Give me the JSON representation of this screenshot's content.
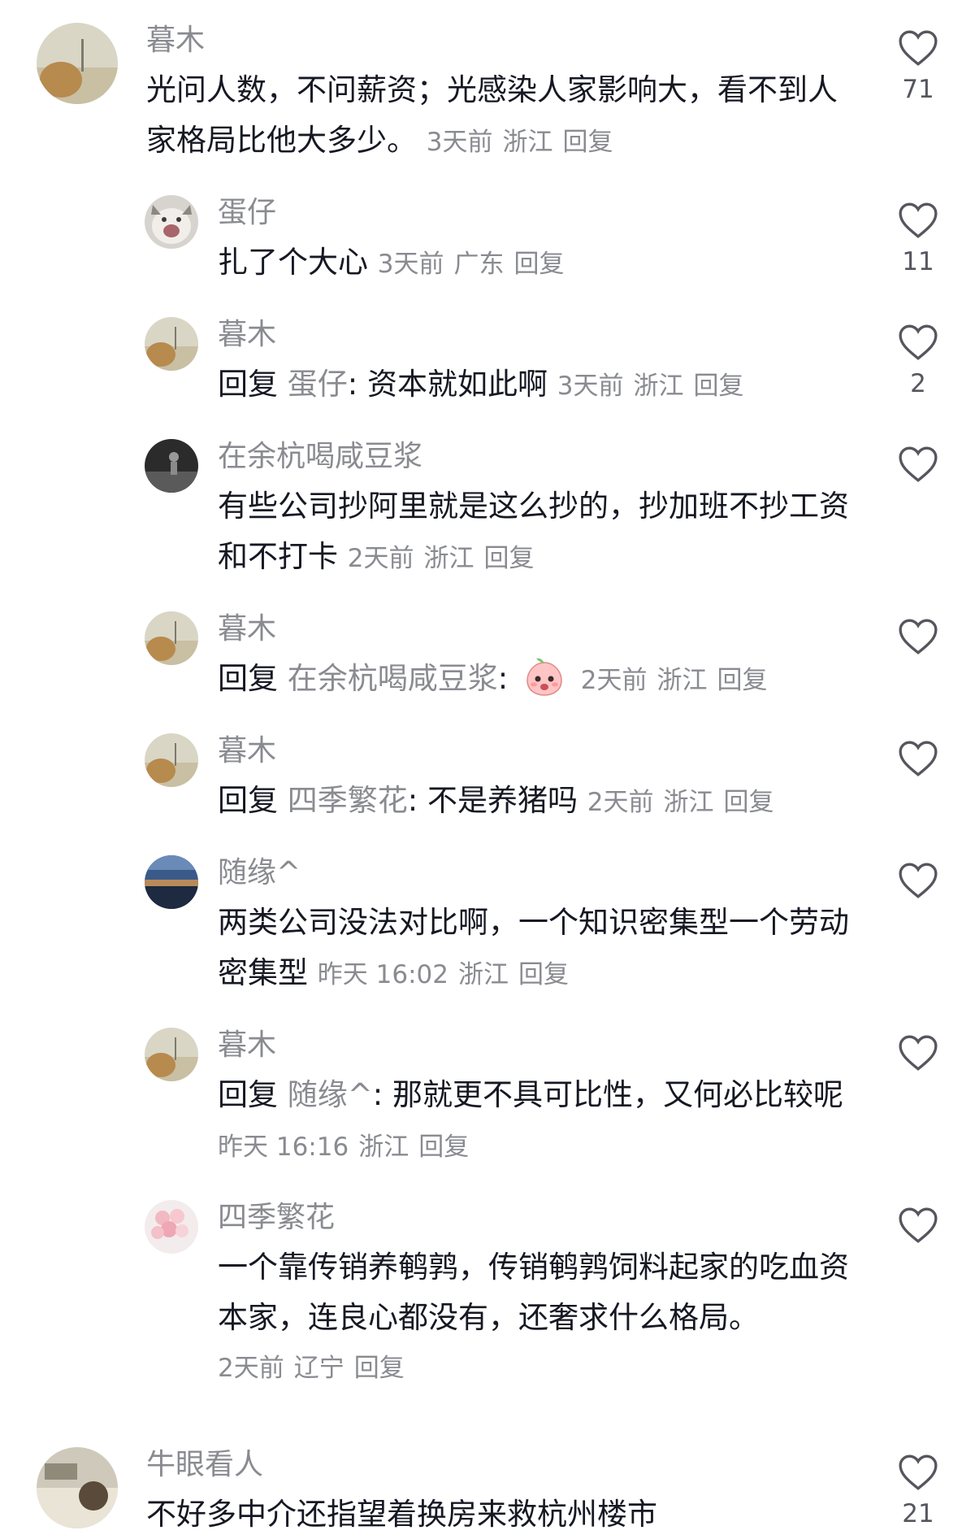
{
  "comments": [
    {
      "user": "暮木",
      "text": "光问人数，不问薪资；光感染人家影响大，看不到人家格局比他大多少。",
      "time": "3天前",
      "location": "浙江",
      "reply_label": "回复",
      "likes": "71"
    },
    {
      "user": "蛋仔",
      "text": "扎了个大心",
      "time": "3天前",
      "location": "广东",
      "reply_label": "回复",
      "likes": "11"
    },
    {
      "user": "暮木",
      "reply_prefix": "回复",
      "reply_to": "蛋仔",
      "text": ": 资本就如此啊",
      "time": "3天前",
      "location": "浙江",
      "reply_label": "回复",
      "likes": "2"
    },
    {
      "user": "在余杭喝咸豆浆",
      "text": "有些公司抄阿里就是这么抄的，抄加班不抄工资和不打卡",
      "time": "2天前",
      "location": "浙江",
      "reply_label": "回复",
      "likes": ""
    },
    {
      "user": "暮木",
      "reply_prefix": "回复",
      "reply_to": "在余杭喝咸豆浆",
      "text": ":",
      "emoji": "peach-face-emoji",
      "time": "2天前",
      "location": "浙江",
      "reply_label": "回复",
      "likes": ""
    },
    {
      "user": "暮木",
      "reply_prefix": "回复",
      "reply_to": "四季繁花",
      "text": ": 不是养猪吗",
      "time": "2天前",
      "location": "浙江",
      "reply_label": "回复",
      "likes": ""
    },
    {
      "user": "随缘^",
      "text": "两类公司没法对比啊，一个知识密集型一个劳动密集型",
      "time": "昨天 16:02",
      "location": "浙江",
      "reply_label": "回复",
      "likes": ""
    },
    {
      "user": "暮木",
      "reply_prefix": "回复",
      "reply_to": "随缘^",
      "text": ": 那就更不具可比性，又何必比较呢",
      "time": "昨天 16:16",
      "location": "浙江",
      "reply_label": "回复",
      "likes": ""
    },
    {
      "user": "四季繁花",
      "text": "一个靠传销养鹌鹑，传销鹌鹑饲料起家的吃血资本家，连良心都没有，还奢求什么格局。",
      "time": "2天前",
      "location": "辽宁",
      "reply_label": "回复",
      "likes": ""
    },
    {
      "user": "牛眼看人",
      "text": "不好多中介还指望着换房来救杭州楼市",
      "likes": "21"
    }
  ],
  "icons": {
    "like": "heart-outline-icon"
  },
  "colors": {
    "text": "#161823",
    "secondary": "#8a8b91",
    "background": "#ffffff"
  }
}
